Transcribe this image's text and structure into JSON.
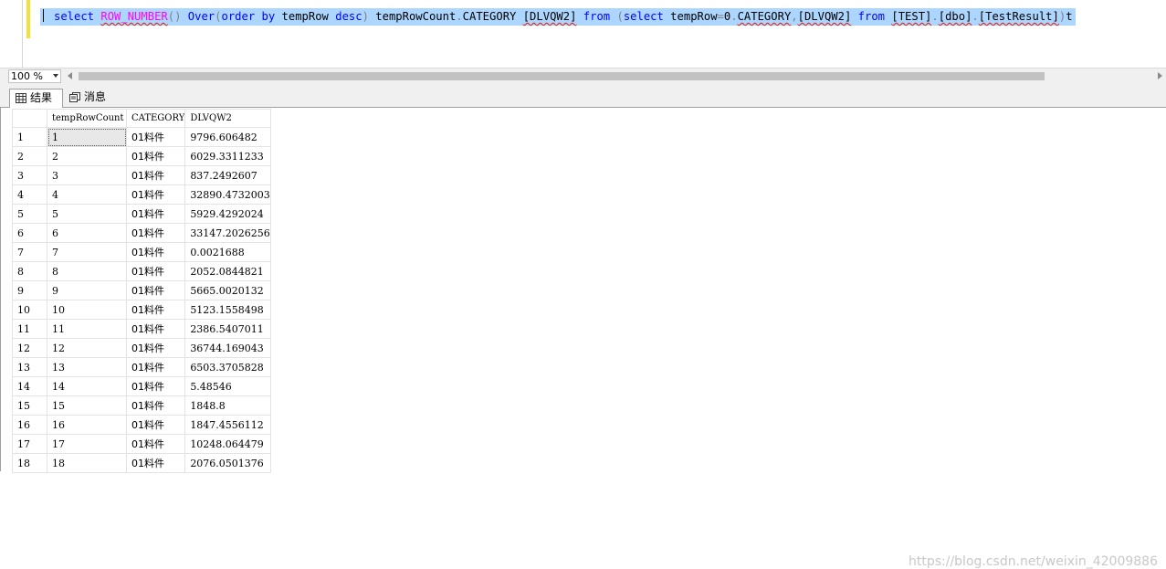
{
  "editor": {
    "sql_tokens": [
      {
        "t": "select",
        "c": "kw"
      },
      {
        "t": " ",
        "c": ""
      },
      {
        "t": "ROW_NUMBER",
        "c": "fn sq"
      },
      {
        "t": "()",
        "c": "gr"
      },
      {
        "t": " ",
        "c": ""
      },
      {
        "t": "Over",
        "c": "kw"
      },
      {
        "t": "(",
        "c": "gr"
      },
      {
        "t": "order by",
        "c": "kw"
      },
      {
        "t": " tempRow ",
        "c": ""
      },
      {
        "t": "desc",
        "c": "kw"
      },
      {
        "t": ")",
        "c": "gr"
      },
      {
        "t": " tempRowCount",
        "c": ""
      },
      {
        "t": ".",
        "c": "gr"
      },
      {
        "t": "CATEGORY ",
        "c": ""
      },
      {
        "t": "[DLVQW2]",
        "c": "sq"
      },
      {
        "t": " ",
        "c": ""
      },
      {
        "t": "from",
        "c": "kw"
      },
      {
        "t": " ",
        "c": ""
      },
      {
        "t": "(",
        "c": "gr"
      },
      {
        "t": "select",
        "c": "kw"
      },
      {
        "t": " tempRow",
        "c": ""
      },
      {
        "t": "=",
        "c": "gr"
      },
      {
        "t": "0",
        "c": ""
      },
      {
        "t": ".",
        "c": "gr"
      },
      {
        "t": "CATEGORY",
        "c": "sq"
      },
      {
        "t": ",",
        "c": "gr"
      },
      {
        "t": "[DLVQW2]",
        "c": "sq"
      },
      {
        "t": " ",
        "c": ""
      },
      {
        "t": "from",
        "c": "kw"
      },
      {
        "t": " ",
        "c": ""
      },
      {
        "t": "[TEST]",
        "c": "sq"
      },
      {
        "t": ".",
        "c": "gr"
      },
      {
        "t": "[dbo]",
        "c": "sq"
      },
      {
        "t": ".",
        "c": "gr"
      },
      {
        "t": "[TestResult]",
        "c": "sq"
      },
      {
        "t": ")",
        "c": "gr"
      },
      {
        "t": "t",
        "c": ""
      }
    ]
  },
  "zoom": {
    "value": "100 %"
  },
  "tabs": [
    {
      "label": "结果",
      "icon": "grid-icon"
    },
    {
      "label": "消息",
      "icon": "messages-icon"
    }
  ],
  "grid": {
    "columns": [
      "tempRowCount",
      "CATEGORY",
      "DLVQW2"
    ],
    "rows": [
      [
        "1",
        "1",
        "01料件",
        "9796.606482"
      ],
      [
        "2",
        "2",
        "01料件",
        "6029.3311233"
      ],
      [
        "3",
        "3",
        "01料件",
        "837.2492607"
      ],
      [
        "4",
        "4",
        "01料件",
        "32890.4732003"
      ],
      [
        "5",
        "5",
        "01料件",
        "5929.4292024"
      ],
      [
        "6",
        "6",
        "01料件",
        "33147.2026256"
      ],
      [
        "7",
        "7",
        "01料件",
        "0.0021688"
      ],
      [
        "8",
        "8",
        "01料件",
        "2052.0844821"
      ],
      [
        "9",
        "9",
        "01料件",
        "5665.0020132"
      ],
      [
        "10",
        "10",
        "01料件",
        "5123.1558498"
      ],
      [
        "11",
        "11",
        "01料件",
        "2386.5407011"
      ],
      [
        "12",
        "12",
        "01料件",
        "36744.169043"
      ],
      [
        "13",
        "13",
        "01料件",
        "6503.3705828"
      ],
      [
        "14",
        "14",
        "01料件",
        "5.48546"
      ],
      [
        "15",
        "15",
        "01料件",
        "1848.8"
      ],
      [
        "16",
        "16",
        "01料件",
        "1847.4556112"
      ],
      [
        "17",
        "17",
        "01料件",
        "10248.064479"
      ],
      [
        "18",
        "18",
        "01料件",
        "2076.0501376"
      ]
    ]
  },
  "watermark": "https://blog.csdn.net/weixin_42009886"
}
